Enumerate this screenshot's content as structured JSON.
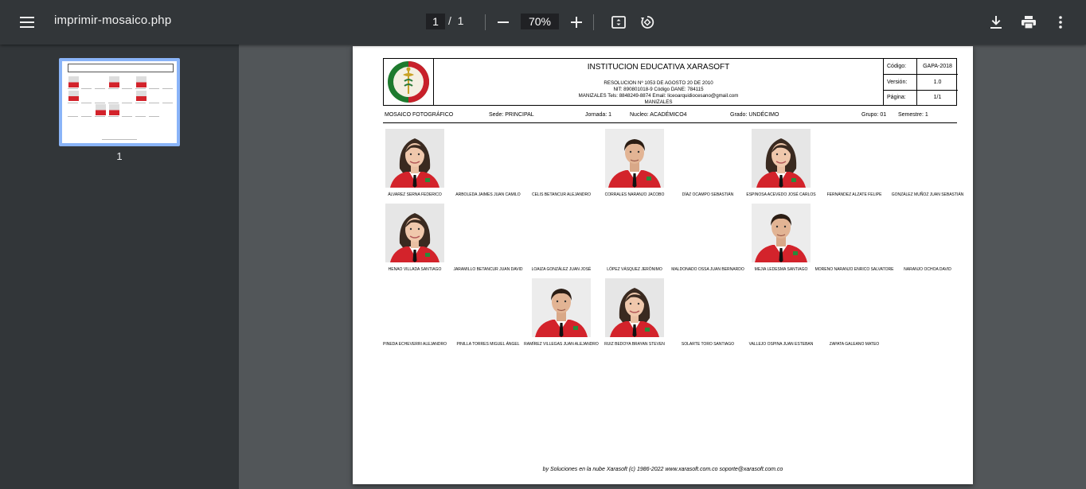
{
  "toolbar": {
    "menu_icon": "menu-icon",
    "title": "imprimir-mosaico.php",
    "page_current": "1",
    "page_sep": "/",
    "page_total": "1",
    "zoom": "70%",
    "icons": [
      "zoom-out-icon",
      "zoom-in-icon",
      "fit-page-icon",
      "rotate-icon",
      "download-icon",
      "print-icon",
      "more-vert-icon"
    ]
  },
  "sidebar": {
    "thumb_label": "1"
  },
  "doc": {
    "institution": "INSTITUCION EDUCATIVA XARASOFT",
    "res_line1": "RESOLUCION Nº 1053 DE AGOSTO 20 DE 2010",
    "res_line2": "NIT: 890801018-9  Código DANE: 784115",
    "res_line3": "MANIZALES  Tels: 8848249-8874  Email: liceoarquidiocesano@gmail.com",
    "res_line4": "MANIZALES",
    "codigo_label": "Código:",
    "codigo_value": "GAPA-2018",
    "version_label": "Versión:",
    "version_value": "1.0",
    "pagina_label": "Página:",
    "pagina_value": "1/1",
    "mosaico": "MOSAICO FOTOGRÁFICO",
    "sede": "Sede: PRINCIPAL",
    "jornada": "Jornada: 1",
    "nucleo": "Nucleo: ACADÉMICO4",
    "grado": "Grado: UNDÉCIMO",
    "grupo": "Grupo: 01",
    "semestre": "Semestre: 1",
    "footer": "by Soluciones en la nube Xarasoft (c) 1986-2022  www.xarasoft.com.co  soporte@xarasoft.com.co"
  },
  "students": [
    {
      "name": "ÁLVAREZ SERNA FEDERICO",
      "photo": "girl"
    },
    {
      "name": "ARBOLEDA JAIMES JUAN CAMILO",
      "photo": ""
    },
    {
      "name": "CELIS BETANCUR ALEJANDRO",
      "photo": ""
    },
    {
      "name": "CORRALES NARANJO JACOBO",
      "photo": "boy"
    },
    {
      "name": "DÍAZ OCAMPO SEBASTIÁN",
      "photo": ""
    },
    {
      "name": "ESPINOSA ACEVEDO JOSÉ CARLOS",
      "photo": "girl"
    },
    {
      "name": "FERNÁNDEZ ALZATE  FELIPE",
      "photo": ""
    },
    {
      "name": "GONZÁLEZ MUÑOZ JUAN SEBASTIÁN",
      "photo": ""
    },
    {
      "name": "HENAO VILLADA SANTIAGO",
      "photo": "girl"
    },
    {
      "name": "JARAMILLO BETANCUR JUAN DAVID",
      "photo": ""
    },
    {
      "name": "LOAIZA GONZÁLEZ JUAN JOSÉ",
      "photo": ""
    },
    {
      "name": "LÓPEZ VÁSQUEZ JERÓNIMO",
      "photo": ""
    },
    {
      "name": "MALDONADO OSSA JUAN BERNARDO",
      "photo": ""
    },
    {
      "name": "MEJIA LEDESMA SANTIAGO",
      "photo": "boy"
    },
    {
      "name": "MORENO NARANJO ENRICO SALVATORE",
      "photo": ""
    },
    {
      "name": "NARANJO OCHOA DAVID",
      "photo": ""
    },
    {
      "name": "PINEDA ECHEVERRI ALEJANDRO",
      "photo": ""
    },
    {
      "name": "PINILLA TORRES MIGUEL ÁNGEL",
      "photo": ""
    },
    {
      "name": "RAMÍREZ VILLEGAS JUAN ALEJANDRO",
      "photo": "boy"
    },
    {
      "name": "RUIZ BEDOYA BRAYAN STEVEN",
      "photo": "girl"
    },
    {
      "name": "SOLARTE TORO SANTIAGO",
      "photo": ""
    },
    {
      "name": "VALLEJO OSPINA JUAN ESTEBAN",
      "photo": ""
    },
    {
      "name": "ZAPATA GALEANO MATEO",
      "photo": ""
    }
  ]
}
